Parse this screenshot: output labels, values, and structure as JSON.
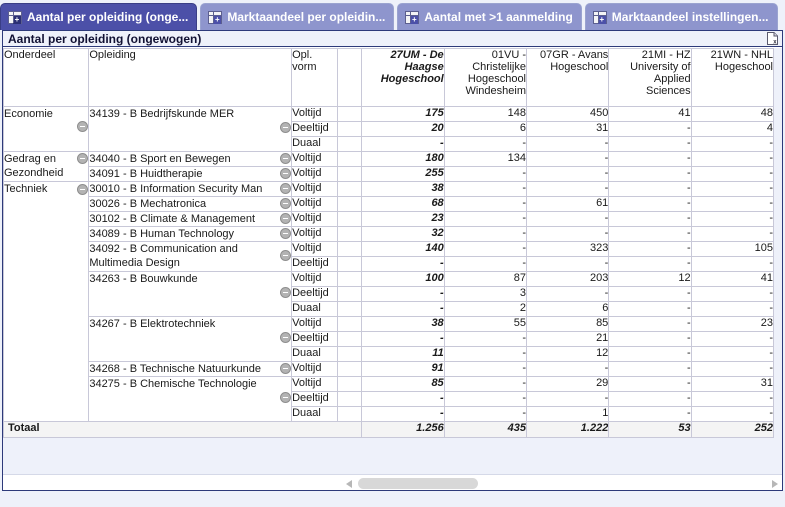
{
  "tabs": [
    {
      "label": "Aantal per opleiding (onge...",
      "icon": "grid-plus-icon",
      "active": true
    },
    {
      "label": "Marktaandeel per opleidin...",
      "icon": "grid-plus-icon",
      "active": false
    },
    {
      "label": "Aantal met >1 aanmelding",
      "icon": "grid-plus-icon",
      "active": false
    },
    {
      "label": "Marktaandeel instellingen...",
      "icon": "grid-plus-icon",
      "active": false
    }
  ],
  "panel": {
    "title": "Aantal per opleiding (ongewogen)",
    "export_icon": "export-document-icon"
  },
  "table": {
    "headers": {
      "onderdeel": "Onderdeel",
      "opleiding": "Opleiding",
      "vorm": "Opl. vorm",
      "gap": ""
    },
    "institutions": [
      {
        "label": "27UM - De Haagse Hogeschool",
        "highlight": true
      },
      {
        "label": "01VU - Christelijke Hogeschool Windesheim",
        "highlight": false
      },
      {
        "label": "07GR - Avans Hogeschool",
        "highlight": false
      },
      {
        "label": "21MI - HZ University of Applied Sciences",
        "highlight": false
      },
      {
        "label": "21WN - NHL Hogeschool",
        "highlight": false
      }
    ],
    "groups": [
      {
        "onderdeel": "Economie",
        "programs": [
          {
            "name": "34139 - B Bedrijfskunde MER",
            "rows": [
              {
                "vorm": "Voltijd",
                "values": [
                  "175",
                  "148",
                  "450",
                  "41",
                  "48"
                ]
              },
              {
                "vorm": "Deeltijd",
                "values": [
                  "20",
                  "6",
                  "31",
                  "-",
                  "4"
                ]
              },
              {
                "vorm": "Duaal",
                "values": [
                  "-",
                  "-",
                  "-",
                  "-",
                  "-"
                ]
              }
            ]
          }
        ]
      },
      {
        "onderdeel": "Gedrag en Gezondheid",
        "programs": [
          {
            "name": "34040 - B Sport en Bewegen",
            "rows": [
              {
                "vorm": "Voltijd",
                "values": [
                  "180",
                  "134",
                  "-",
                  "-",
                  "-"
                ]
              }
            ]
          },
          {
            "name": "34091 - B Huidtherapie",
            "rows": [
              {
                "vorm": "Voltijd",
                "values": [
                  "255",
                  "-",
                  "-",
                  "-",
                  "-"
                ]
              }
            ]
          }
        ]
      },
      {
        "onderdeel": "Techniek",
        "programs": [
          {
            "name": "30010 - B Information Security Man",
            "rows": [
              {
                "vorm": "Voltijd",
                "values": [
                  "38",
                  "-",
                  "-",
                  "-",
                  "-"
                ]
              }
            ]
          },
          {
            "name": "30026 - B Mechatronica",
            "rows": [
              {
                "vorm": "Voltijd",
                "values": [
                  "68",
                  "-",
                  "61",
                  "-",
                  "-"
                ]
              }
            ]
          },
          {
            "name": "30102 - B Climate & Management",
            "rows": [
              {
                "vorm": "Voltijd",
                "values": [
                  "23",
                  "-",
                  "-",
                  "-",
                  "-"
                ]
              }
            ]
          },
          {
            "name": "34089 - B Human Technology",
            "rows": [
              {
                "vorm": "Voltijd",
                "values": [
                  "32",
                  "-",
                  "-",
                  "-",
                  "-"
                ]
              }
            ]
          },
          {
            "name": "34092 - B Communication and Multimedia Design",
            "rows": [
              {
                "vorm": "Voltijd",
                "values": [
                  "140",
                  "-",
                  "323",
                  "-",
                  "105"
                ]
              },
              {
                "vorm": "Deeltijd",
                "values": [
                  "-",
                  "-",
                  "-",
                  "-",
                  "-"
                ]
              }
            ]
          },
          {
            "name": "34263 - B Bouwkunde",
            "rows": [
              {
                "vorm": "Voltijd",
                "values": [
                  "100",
                  "87",
                  "203",
                  "12",
                  "41"
                ]
              },
              {
                "vorm": "Deeltijd",
                "values": [
                  "-",
                  "3",
                  "-",
                  "-",
                  "-"
                ]
              },
              {
                "vorm": "Duaal",
                "values": [
                  "-",
                  "2",
                  "6",
                  "-",
                  "-"
                ]
              }
            ]
          },
          {
            "name": "34267 - B Elektrotechniek",
            "rows": [
              {
                "vorm": "Voltijd",
                "values": [
                  "38",
                  "55",
                  "85",
                  "-",
                  "23"
                ]
              },
              {
                "vorm": "Deeltijd",
                "values": [
                  "-",
                  "-",
                  "21",
                  "-",
                  "-"
                ]
              },
              {
                "vorm": "Duaal",
                "values": [
                  "11",
                  "-",
                  "12",
                  "-",
                  "-"
                ]
              }
            ]
          },
          {
            "name": "34268 - B Technische Natuurkunde",
            "rows": [
              {
                "vorm": "Voltijd",
                "values": [
                  "91",
                  "-",
                  "-",
                  "-",
                  "-"
                ]
              }
            ]
          },
          {
            "name": "34275 - B Chemische Technologie",
            "rows": [
              {
                "vorm": "Voltijd",
                "values": [
                  "85",
                  "-",
                  "29",
                  "-",
                  "31"
                ]
              },
              {
                "vorm": "Deeltijd",
                "values": [
                  "-",
                  "-",
                  "-",
                  "-",
                  "-"
                ]
              },
              {
                "vorm": "Duaal",
                "values": [
                  "-",
                  "-",
                  "1",
                  "-",
                  "-"
                ]
              }
            ]
          }
        ]
      }
    ],
    "total": {
      "label": "Totaal",
      "values": [
        "1.256",
        "435",
        "1.222",
        "53",
        "252"
      ]
    },
    "collapse_icon": "collapse-minus-icon"
  },
  "scrollbar": {
    "left_arrow_icon": "arrow-left-icon",
    "right_arrow_icon": "arrow-right-icon"
  },
  "colors": {
    "tab_active": "#4c50a8",
    "tab_inactive": "#8e95cd",
    "panel_border": "#2d3a7a",
    "background": "#eef1fa"
  }
}
